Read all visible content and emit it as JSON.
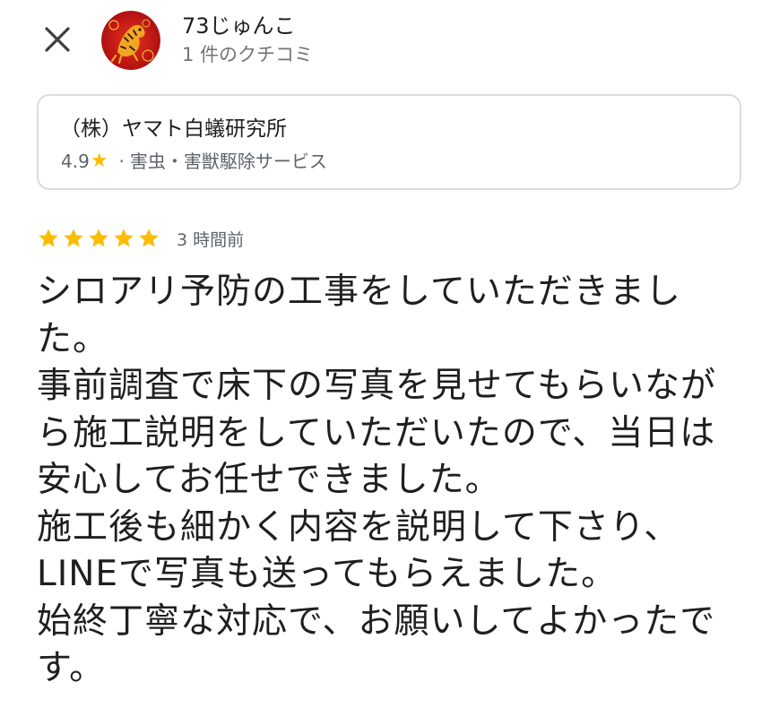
{
  "reviewer": {
    "name": "73じゅんこ",
    "meta": "1 件のクチコミ",
    "avatar_icon": "tiger-avatar-icon"
  },
  "header": {
    "close_icon": "close-icon"
  },
  "place": {
    "name": "（株）ヤマト白蟻研究所",
    "rating": "4.9",
    "rating_star": "★",
    "separator1": "·",
    "category": "害虫・害獣駆除サービス"
  },
  "review": {
    "stars": 5,
    "star_color": "#fbbc04",
    "time": "3 時間前",
    "lines": [
      "シロアリ予防の工事をしていただきまし",
      "た。",
      "事前調査で床下の写真を見せてもらいなが",
      "ら施工説明をしていただいたので、当日は",
      "安心してお任せできました。",
      "施工後も細かく内容を説明して下さり、",
      "LINEで写真も送ってもらえました。",
      "始終丁寧な対応で、お願いしてよかったで",
      "す。"
    ]
  }
}
